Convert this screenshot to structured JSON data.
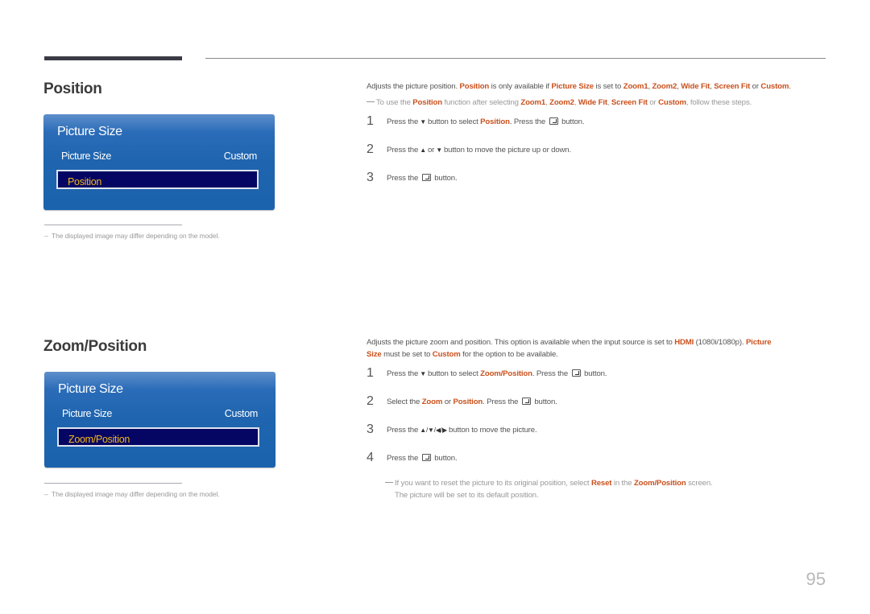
{
  "page_number": "95",
  "colors": {
    "highlight": "#c9501c",
    "panel_blue": "#1e64ae",
    "selection_bg": "#050663",
    "selection_text": "#f2b71b"
  },
  "sections": [
    {
      "title": "Position",
      "menu": {
        "title": "Picture Size",
        "row_label": "Picture Size",
        "row_value": "Custom",
        "selected_item": "Position",
        "bullet": "·"
      },
      "footnote": "The displayed image may differ depending on the model.",
      "footnote_dash": "–",
      "description": {
        "t1": "Adjusts the picture position. ",
        "h1": "Position",
        "t2": " is only available if ",
        "h2": "Picture Size",
        "t3": " is set to ",
        "h3": "Zoom1",
        "t4": ", ",
        "h4": "Zoom2",
        "t5": ", ",
        "h5": "Wide Fit",
        "t6": ", ",
        "h6": "Screen Fit",
        "t7": " or ",
        "h7": "Custom",
        "t8": "."
      },
      "note": {
        "t1": "To use the ",
        "h1": "Position",
        "t2": " function after selecting ",
        "h2": "Zoom1",
        "t3": ", ",
        "h3": "Zoom2",
        "t4": ", ",
        "h4": "Wide Fit",
        "t5": ", ",
        "h5": "Screen Fit",
        "t6": " or ",
        "h6": "Custom",
        "t7": ", follow these steps."
      },
      "steps": [
        {
          "num": "1",
          "t1": "Press the",
          "icon1": "▼",
          "t2": "button to select ",
          "h1": "Position",
          "t3": ". Press the",
          "t4": "button."
        },
        {
          "num": "2",
          "t1": "Press the",
          "icon1": "▲",
          "t2": "or",
          "icon2": "▼",
          "t3": "button to move the picture up or down."
        },
        {
          "num": "3",
          "t1": "Press the",
          "t2": "button."
        }
      ]
    },
    {
      "title": "Zoom/Position",
      "menu": {
        "title": "Picture Size",
        "row_label": "Picture Size",
        "row_value": "Custom",
        "selected_item": "Zoom/Position",
        "bullet": "·"
      },
      "footnote": "The displayed image may differ depending on the model.",
      "footnote_dash": "–",
      "description": {
        "t1": "Adjusts the picture zoom and position. This option is available when the input source is set to ",
        "h1": "HDMI",
        "t2": " (1080i/1080p). ",
        "h2": "Picture",
        "h3": "Size",
        "t3": " must be set to ",
        "h4": "Custom",
        "t4": " for the option to be available."
      },
      "steps": [
        {
          "num": "1",
          "t1": "Press the",
          "icon1": "▼",
          "t2": "button to select ",
          "h1": "Zoom/Position",
          "t3": ". Press the",
          "t4": "button."
        },
        {
          "num": "2",
          "t1": "Select the ",
          "h1": "Zoom",
          "t2": " or ",
          "h2": "Position",
          "t3": ". Press the",
          "t4": "button."
        },
        {
          "num": "3",
          "t1": "Press the",
          "icon1": "▲/▼/◀/▶",
          "t2": "button to move the picture."
        },
        {
          "num": "4",
          "t1": "Press the",
          "t2": "button."
        }
      ],
      "note": {
        "t1": "If you want to reset the picture to its original position, select ",
        "h1": "Reset",
        "t2": " in the ",
        "h2": "Zoom/Position",
        "t3": " screen.",
        "line2": "The picture will be set to its default position."
      }
    }
  ]
}
